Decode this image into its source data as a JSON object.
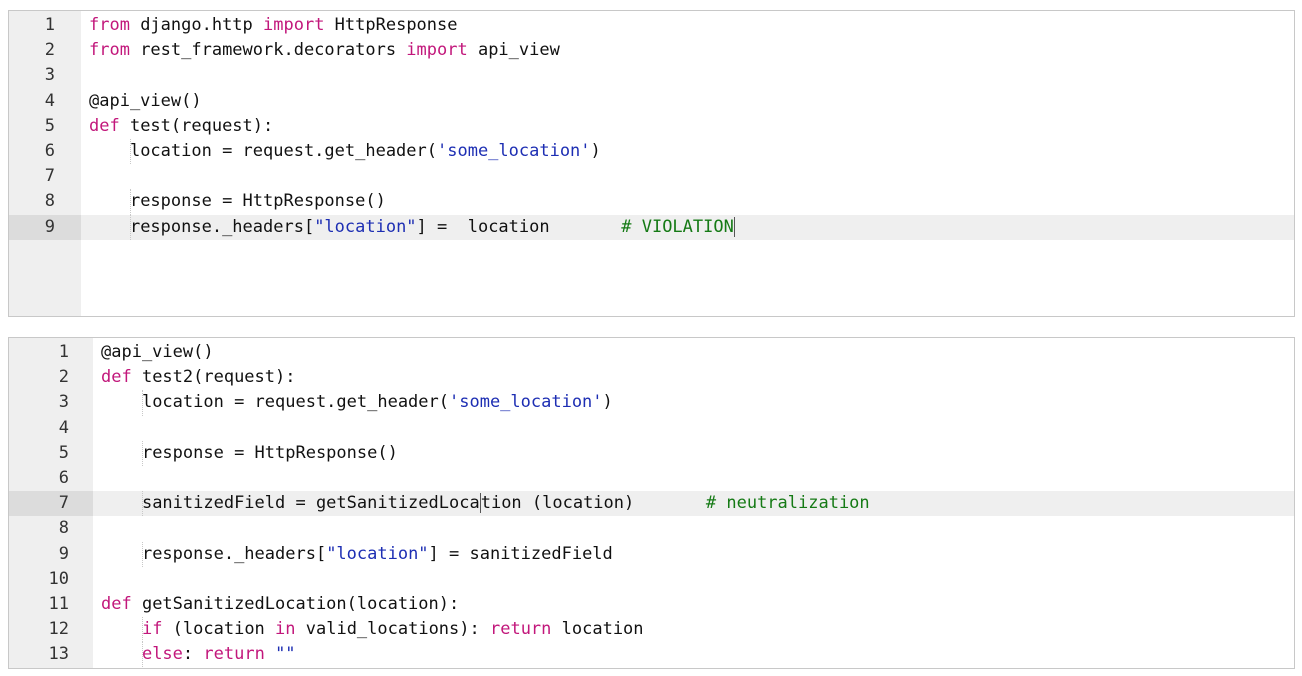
{
  "editor1": {
    "active_line": 9,
    "lines": [
      {
        "num": "1",
        "tokens": [
          [
            "kw",
            "from"
          ],
          [
            "plain",
            " django.http "
          ],
          [
            "kw",
            "import"
          ],
          [
            "plain",
            " HttpResponse"
          ]
        ]
      },
      {
        "num": "2",
        "tokens": [
          [
            "kw",
            "from"
          ],
          [
            "plain",
            " rest_framework.decorators "
          ],
          [
            "kw",
            "import"
          ],
          [
            "plain",
            " api_view"
          ]
        ]
      },
      {
        "num": "3",
        "tokens": []
      },
      {
        "num": "4",
        "tokens": [
          [
            "plain",
            "@api_view()"
          ]
        ]
      },
      {
        "num": "5",
        "tokens": [
          [
            "kw",
            "def"
          ],
          [
            "plain",
            " test(request):"
          ]
        ]
      },
      {
        "num": "6",
        "indent": true,
        "tokens": [
          [
            "plain",
            "    location = request.get_header("
          ],
          [
            "str",
            "'some_location'"
          ],
          [
            "plain",
            ")"
          ]
        ]
      },
      {
        "num": "7",
        "tokens": []
      },
      {
        "num": "8",
        "indent": true,
        "tokens": [
          [
            "plain",
            "    response = HttpResponse()"
          ]
        ]
      },
      {
        "num": "9",
        "indent": true,
        "tokens": [
          [
            "plain",
            "    response._headers["
          ],
          [
            "str",
            "\"location\""
          ],
          [
            "plain",
            "] =  location       "
          ],
          [
            "cmt",
            "# VIOLATION"
          ]
        ],
        "caret_end": true
      }
    ]
  },
  "editor2": {
    "active_line": 7,
    "lines": [
      {
        "num": "1",
        "tokens": [
          [
            "plain",
            "@api_view()"
          ]
        ]
      },
      {
        "num": "2",
        "tokens": [
          [
            "kw",
            "def"
          ],
          [
            "plain",
            " test2(request):"
          ]
        ]
      },
      {
        "num": "3",
        "indent": true,
        "tokens": [
          [
            "plain",
            "    location = request.get_header("
          ],
          [
            "str",
            "'some_location'"
          ],
          [
            "plain",
            ")"
          ]
        ]
      },
      {
        "num": "4",
        "tokens": []
      },
      {
        "num": "5",
        "indent": true,
        "tokens": [
          [
            "plain",
            "    response = HttpResponse()"
          ]
        ]
      },
      {
        "num": "6",
        "tokens": []
      },
      {
        "num": "7",
        "indent": true,
        "tokens": [
          [
            "plain",
            "    sanitizedField = getSanitizedLoca"
          ],
          [
            "caret",
            ""
          ],
          [
            "plain",
            "tion (location)       "
          ],
          [
            "cmt",
            "# neutralization"
          ]
        ]
      },
      {
        "num": "8",
        "tokens": []
      },
      {
        "num": "9",
        "indent": true,
        "tokens": [
          [
            "plain",
            "    response._headers["
          ],
          [
            "str",
            "\"location\""
          ],
          [
            "plain",
            "] = sanitizedField"
          ]
        ]
      },
      {
        "num": "10",
        "tokens": []
      },
      {
        "num": "11",
        "tokens": [
          [
            "kw",
            "def"
          ],
          [
            "plain",
            " getSanitizedLocation(location):"
          ]
        ]
      },
      {
        "num": "12",
        "indent": true,
        "tokens": [
          [
            "plain",
            "    "
          ],
          [
            "kw",
            "if"
          ],
          [
            "plain",
            " (location "
          ],
          [
            "kw",
            "in"
          ],
          [
            "plain",
            " valid_locations): "
          ],
          [
            "kw",
            "return"
          ],
          [
            "plain",
            " location"
          ]
        ]
      },
      {
        "num": "13",
        "indent": true,
        "tokens": [
          [
            "plain",
            "    "
          ],
          [
            "kw",
            "else"
          ],
          [
            "plain",
            ": "
          ],
          [
            "kw",
            "return"
          ],
          [
            "plain",
            " "
          ],
          [
            "str",
            "\"\""
          ]
        ]
      }
    ]
  }
}
